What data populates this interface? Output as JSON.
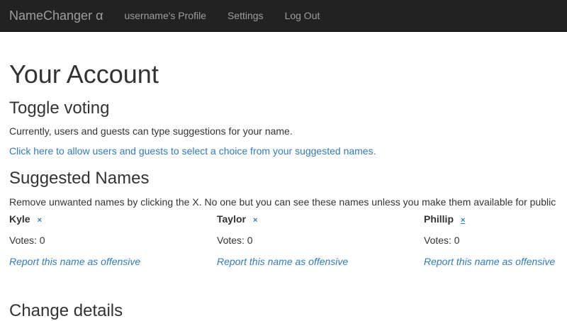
{
  "nav": {
    "brand": "NameChanger α",
    "links": [
      "username's Profile",
      "Settings",
      "Log Out"
    ]
  },
  "page_title": "Your Account",
  "toggle": {
    "heading": "Toggle voting",
    "status": "Currently, users and guests can type suggestions for your name.",
    "link": "Click here to allow users and guests to select a choice from your suggested names."
  },
  "suggested": {
    "heading": "Suggested Names",
    "description": "Remove unwanted names by clicking the X. No one but you can see these names unless you make them available for public",
    "names": [
      {
        "name": "Kyle",
        "remove": "×",
        "votes": "Votes: 0",
        "report": "Report this name as offensive"
      },
      {
        "name": "Taylor",
        "remove": "×",
        "votes": "Votes: 0",
        "report": "Report this name as offensive"
      },
      {
        "name": "Phillip",
        "remove": "×",
        "votes": "Votes: 0",
        "report": "Report this name as offensive"
      }
    ]
  },
  "change_details": {
    "heading": "Change details"
  }
}
